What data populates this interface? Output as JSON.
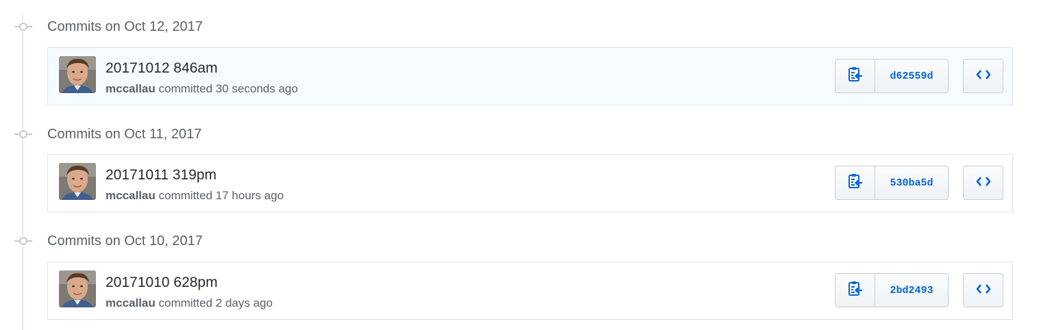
{
  "groups": [
    {
      "title": "Commits on Oct 12, 2017",
      "commits": [
        {
          "title": "20171012 846am",
          "author": "mccallau",
          "action": "committed",
          "time": "30 seconds ago",
          "sha": "d62559d",
          "highlighted": true
        }
      ]
    },
    {
      "title": "Commits on Oct 11, 2017",
      "commits": [
        {
          "title": "20171011 319pm",
          "author": "mccallau",
          "action": "committed",
          "time": "17 hours ago",
          "sha": "530ba5d",
          "highlighted": false
        }
      ]
    },
    {
      "title": "Commits on Oct 10, 2017",
      "commits": [
        {
          "title": "20171010 628pm",
          "author": "mccallau",
          "action": "committed",
          "time": "2 days ago",
          "sha": "2bd2493",
          "highlighted": false
        }
      ]
    }
  ],
  "icons": {
    "timeline": "git-commit-icon",
    "copy": "clippy-icon",
    "browse": "code-icon"
  },
  "colors": {
    "link": "#0366d6",
    "muted": "#586069",
    "highlight_bg": "#f6fbff",
    "border": "#e1e4e8"
  }
}
